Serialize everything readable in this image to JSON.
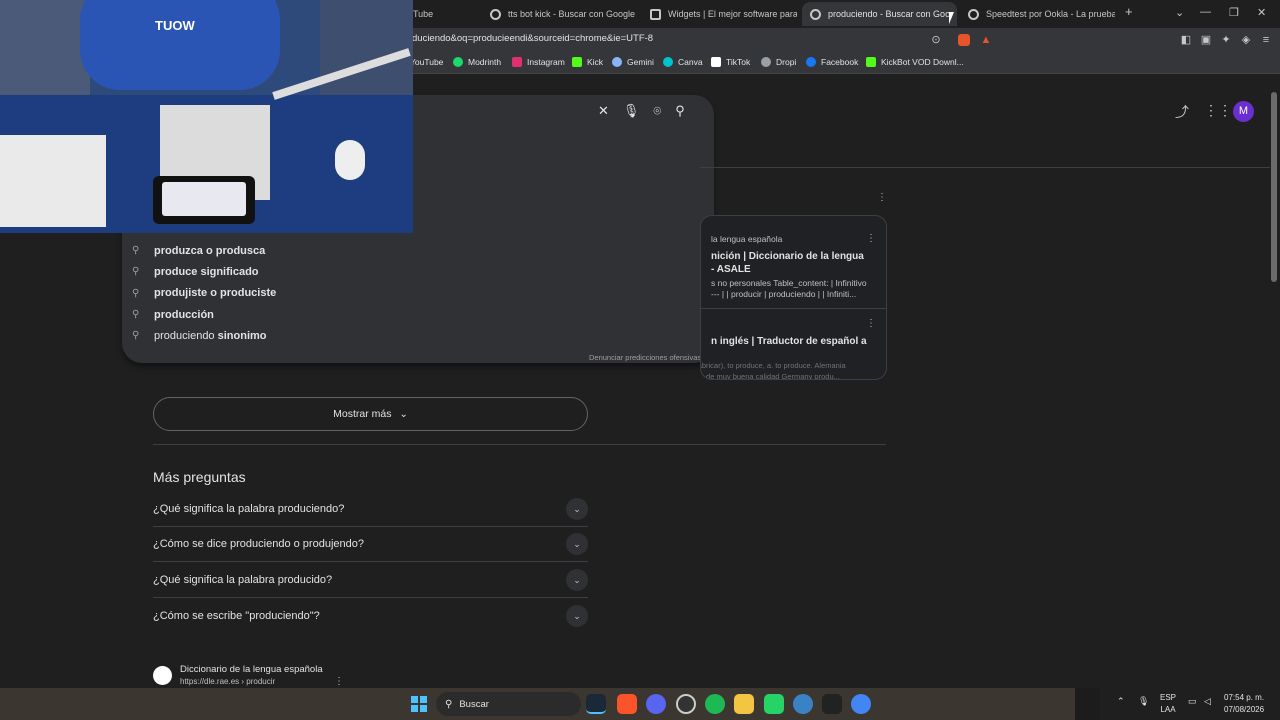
{
  "browser": {
    "tabs": [
      {
        "label": "Tube"
      },
      {
        "label": "tts bot kick - Buscar con Google"
      },
      {
        "label": "Widgets | El mejor software para pe"
      },
      {
        "label": "produciendo - Buscar con Goo"
      },
      {
        "label": "Speedtest por Ookla - La prueba de"
      }
    ],
    "new_tab": "+",
    "url": "duciendo&oq=producieendi&sourceid=chrome&ie=UTF-8",
    "bookmarks": [
      {
        "label": "YouTube",
        "color": "#ff0000"
      },
      {
        "label": "Modrinth",
        "color": "#1bd96a"
      },
      {
        "label": "Instagram",
        "color": "#e1306c"
      },
      {
        "label": "Kick",
        "color": "#53fc18"
      },
      {
        "label": "Gemini",
        "color": "#8ab4f8"
      },
      {
        "label": "Canva",
        "color": "#00c4cc"
      },
      {
        "label": "TikTok",
        "color": "#ffffff"
      },
      {
        "label": "Dropi",
        "color": "#9aa0a6"
      },
      {
        "label": "Facebook",
        "color": "#1877f2"
      },
      {
        "label": "KickBot VOD Downl...",
        "color": "#53fc18"
      }
    ]
  },
  "webcam": {
    "shirt_text": "TUOW"
  },
  "search": {
    "suggestions": [
      {
        "prefix": "",
        "bold": "produzca o produsca"
      },
      {
        "prefix": "",
        "bold": "produce significado"
      },
      {
        "prefix": "",
        "bold": "produjiste o produciste"
      },
      {
        "prefix": "",
        "bold": "producción"
      },
      {
        "prefix": "produciendo ",
        "bold": "sinonimo"
      }
    ],
    "report_label": "Denunciar predicciones ofensivas"
  },
  "right_card": {
    "source": "la lengua española",
    "title1": "nición | Diccionario de la lengua",
    "title1b": "- ASALE",
    "snippet1": "s no personales Table_content: | Infinitivo",
    "snippet1b": "--- | | producir | produciendo | | Infiniti...",
    "title2": "n inglés | Traductor de español a",
    "snippet2": "producir - 1. (fabricar), to produce, a. to produce. Alemania",
    "snippet2b": "produce coches de muy buena calidad Germany produ..."
  },
  "header": {
    "avatar_letter": "M"
  },
  "main": {
    "show_more": "Mostrar más",
    "more_questions_title": "Más preguntas",
    "questions": [
      "¿Qué significa la palabra produciendo?",
      "¿Cómo se dice produciendo o produjendo?",
      "¿Qué significa la palabra producido?",
      "¿Cómo se escribe \"produciendo\"?"
    ],
    "result_site": "Diccionario de la lengua española",
    "result_url": "https://dle.rae.es › producir"
  },
  "taskbar": {
    "search_label": "Buscar",
    "lang_top": "ESP",
    "lang_bottom": "LAA",
    "time": "07:54 p. m.",
    "date": "07/08/2026"
  }
}
